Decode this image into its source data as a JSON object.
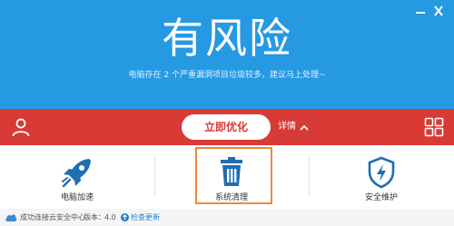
{
  "header": {
    "headline": "有风险",
    "subtext": "电脑存在 2 个严重漏洞项目垃圾较多，建议马上处理~",
    "window_controls": {
      "minimize_icon": "minimize-icon",
      "close_icon": "close-icon"
    }
  },
  "action_bar": {
    "user_icon": "user-icon",
    "optimize_label": "立即优化",
    "details_label": "详情",
    "details_icon": "chevron-up-icon",
    "apps_icon": "grid-icon"
  },
  "tiles": [
    {
      "label": "电脑加速",
      "icon": "rocket-icon"
    },
    {
      "label": "系统清理",
      "icon": "trash-icon"
    },
    {
      "label": "安全维护",
      "icon": "shield-bolt-icon"
    }
  ],
  "status_bar": {
    "cloud_status": "成功连接云安全中心",
    "version_label": "版本：",
    "version_value": "4.0",
    "update_label": "检查更新"
  },
  "colors": {
    "header_blue": "#2699e3",
    "alert_red": "#d83a36",
    "highlight_orange": "#f0883c",
    "icon_blue": "#1f6fb2"
  }
}
